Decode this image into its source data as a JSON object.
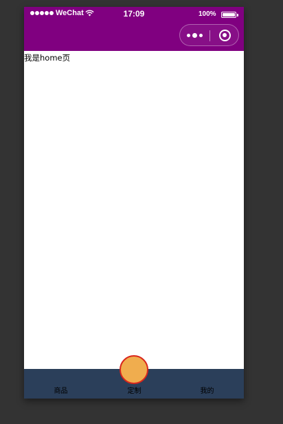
{
  "status_bar": {
    "carrier": "WeChat",
    "time": "17:09",
    "battery": "100%"
  },
  "nav_bar": {
    "background": "#800080",
    "more_icon": "more-dots-icon",
    "close_icon": "close-target-icon"
  },
  "content": {
    "text": "我是home页"
  },
  "tab_bar": {
    "background": "#2b3f5a",
    "items": [
      {
        "label": "商品"
      },
      {
        "label": "定制"
      },
      {
        "label": "我的"
      }
    ],
    "center_button": {
      "fill": "#f0ad4e",
      "border": "#d9261c"
    }
  }
}
